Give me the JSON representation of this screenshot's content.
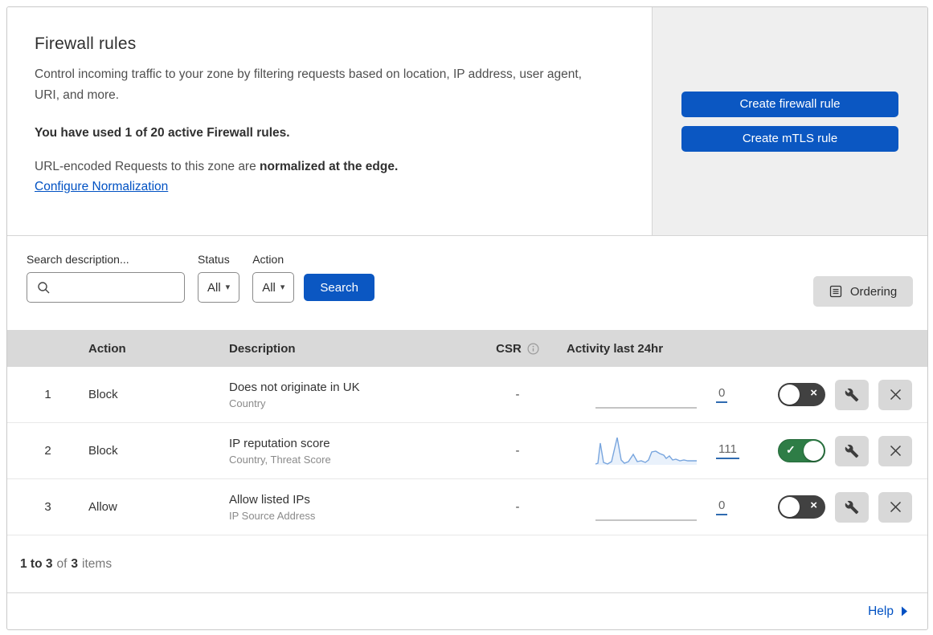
{
  "header": {
    "title": "Firewall rules",
    "description": "Control incoming traffic to your zone by filtering requests based on location, IP address, user agent, URI, and more.",
    "usage_notice": "You have used 1 of 20 active Firewall rules.",
    "normalization_text": "URL-encoded Requests to this zone are ",
    "normalization_bold": "normalized at the edge.",
    "normalization_link": "Configure Normalization",
    "create_firewall_rule_label": "Create firewall rule",
    "create_mtls_rule_label": "Create mTLS rule"
  },
  "filters": {
    "search_label": "Search description...",
    "search_placeholder": "",
    "status_label": "Status",
    "status_value": "All",
    "action_label": "Action",
    "action_value": "All",
    "search_button_label": "Search",
    "ordering_button_label": "Ordering"
  },
  "table": {
    "columns": {
      "action": "Action",
      "description": "Description",
      "csr": "CSR",
      "activity": "Activity last 24hr"
    },
    "rows": [
      {
        "priority": "1",
        "action": "Block",
        "description": "Does not originate in UK",
        "fields": "Country",
        "csr": "-",
        "activity_count": "0",
        "enabled": false
      },
      {
        "priority": "2",
        "action": "Block",
        "description": "IP reputation score",
        "fields": "Country, Threat Score",
        "csr": "-",
        "activity_count": "111",
        "enabled": true
      },
      {
        "priority": "3",
        "action": "Allow",
        "description": "Allow listed IPs",
        "fields": "IP Source Address",
        "csr": "-",
        "activity_count": "0",
        "enabled": false
      }
    ]
  },
  "footer": {
    "range": "1 to 3",
    "of_text": "of",
    "total": "3",
    "items_text": "items",
    "help_label": "Help"
  },
  "icons": {
    "dropdown_caret": "▾",
    "toggle_on_check": "✓",
    "toggle_off_x": "×"
  },
  "colors": {
    "primary_button_blue": "#0b57c2",
    "link_blue": "#0051c3",
    "toggle_on_green": "#2e7d46",
    "toggle_off_dark": "#414141",
    "table_header_grey": "#d9d9d9",
    "side_panel_grey": "#efefef"
  }
}
